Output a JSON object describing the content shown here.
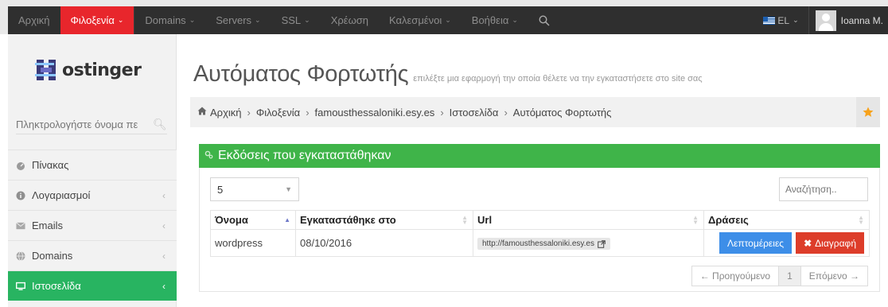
{
  "topnav": {
    "items": [
      {
        "label": "Αρχική",
        "caret": false
      },
      {
        "label": "Φιλοξενία",
        "caret": true,
        "active": true
      },
      {
        "label": "Domains",
        "caret": true
      },
      {
        "label": "Servers",
        "caret": true
      },
      {
        "label": "SSL",
        "caret": true
      },
      {
        "label": "Χρέωση",
        "caret": false
      },
      {
        "label": "Καλεσμένοι",
        "caret": true
      },
      {
        "label": "Βοήθεια",
        "caret": true
      }
    ],
    "caret_glyph": "⌄",
    "search_icon": "search-icon",
    "language": "EL",
    "user_name": "Ioanna M.",
    "active_color": "#e8262c",
    "bar_color": "#2f2f2f"
  },
  "sidebar": {
    "logo_text": "ostinger",
    "search_placeholder": "Πληκτρολογήστε όνομα πε",
    "items": [
      {
        "label": "Πίνακας",
        "icon": "dashboard-icon",
        "chevron": false
      },
      {
        "label": "Λογαριασμοί",
        "icon": "info-icon",
        "chevron": true
      },
      {
        "label": "Emails",
        "icon": "envelope-icon",
        "chevron": true
      },
      {
        "label": "Domains",
        "icon": "globe-icon",
        "chevron": true
      },
      {
        "label": "Ιστοσελίδα",
        "icon": "desktop-icon",
        "chevron": true,
        "active": true
      }
    ],
    "active_color": "#28b461"
  },
  "page": {
    "title": "Αυτόματος Φορτωτής",
    "subtitle": "επιλέξτε μια εφαρμογή την οποία θέλετε να την εγκαταστήσετε στο site σας"
  },
  "breadcrumb": {
    "items": [
      "Αρχική",
      "Φιλοξενία",
      "famousthessaloniki.esy.es",
      "Ιστοσελίδα",
      "Αυτόματος Φορτωτής"
    ],
    "separator": "›",
    "star_color": "#f7a21b"
  },
  "panel": {
    "title": "Εκδόσεις που εγκαταστάθηκαν",
    "header_color": "#3fb449",
    "page_length": "5",
    "search_placeholder": "Αναζήτηση..",
    "columns": [
      "Όνομα",
      "Εγκαταστάθηκε στο",
      "Url",
      "Δράσεις"
    ],
    "rows": [
      {
        "name": "wordpress",
        "installed": "08/10/2016",
        "url": "http://famousthessaloniki.esy.es",
        "details_label": "Λεπτομέρειες",
        "delete_label": "Διαγραφή"
      }
    ],
    "pagination": {
      "prev": "← Προηγούμενο",
      "page": "1",
      "next": "Επόμενο →"
    }
  }
}
